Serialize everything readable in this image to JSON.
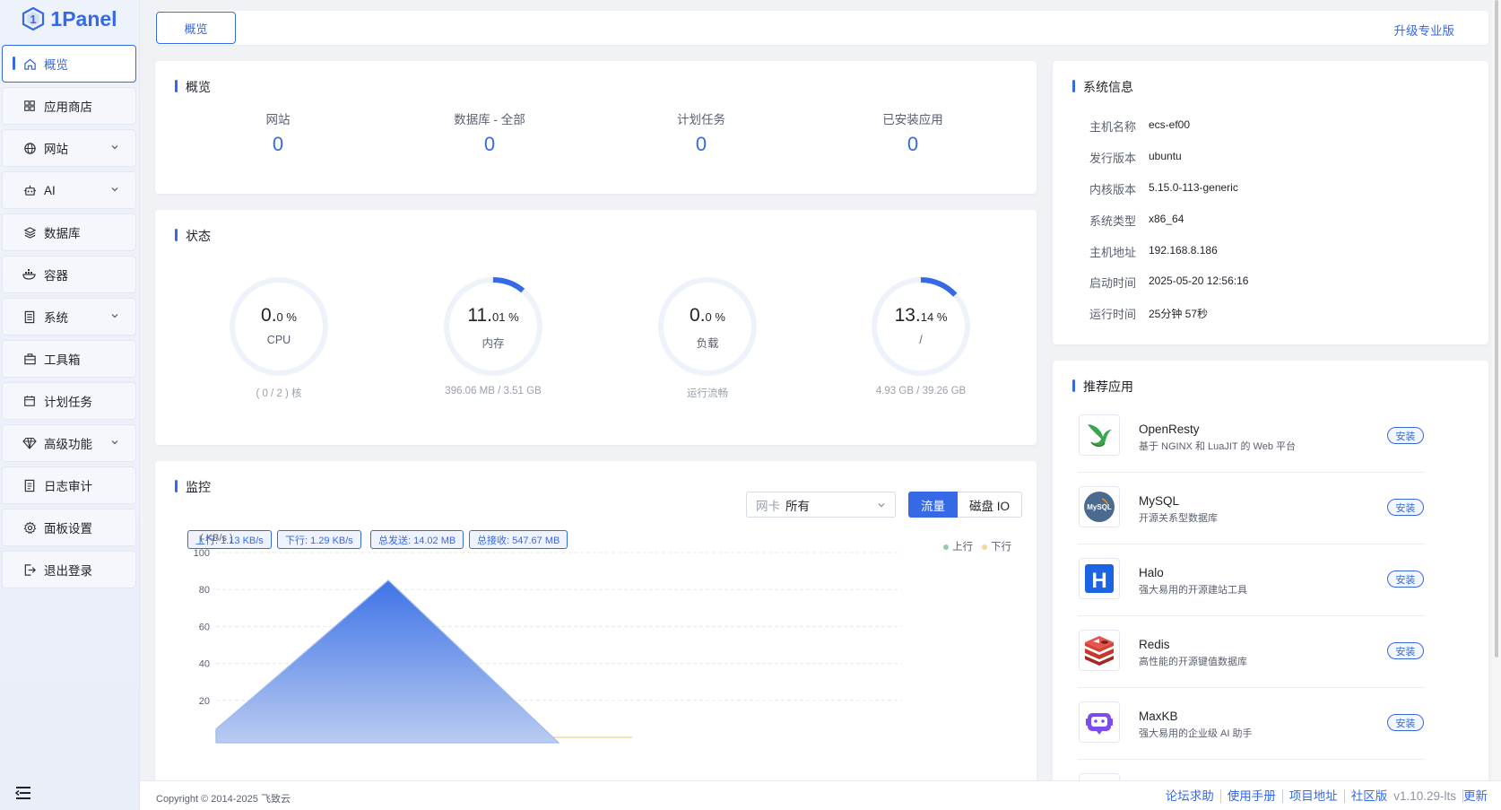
{
  "brand": {
    "name": "1Panel",
    "color": "#3569e6"
  },
  "sidebar": {
    "items": [
      {
        "label": "概览",
        "icon": "home-icon",
        "active": true
      },
      {
        "label": "应用商店",
        "icon": "grid-icon"
      },
      {
        "label": "网站",
        "icon": "globe-icon",
        "expandable": true
      },
      {
        "label": "AI",
        "icon": "robot-icon",
        "expandable": true
      },
      {
        "label": "数据库",
        "icon": "layers-icon"
      },
      {
        "label": "容器",
        "icon": "docker-icon"
      },
      {
        "label": "系统",
        "icon": "server-icon",
        "expandable": true
      },
      {
        "label": "工具箱",
        "icon": "toolbox-icon"
      },
      {
        "label": "计划任务",
        "icon": "calendar-icon"
      },
      {
        "label": "高级功能",
        "icon": "diamond-icon",
        "expandable": true
      },
      {
        "label": "日志审计",
        "icon": "log-icon"
      },
      {
        "label": "面板设置",
        "icon": "gear-icon"
      },
      {
        "label": "退出登录",
        "icon": "logout-icon"
      }
    ]
  },
  "topbar": {
    "tab": "概览",
    "upgrade": "升级专业版"
  },
  "overview": {
    "title": "概览",
    "items": [
      {
        "label": "网站",
        "value": "0"
      },
      {
        "label": "数据库 - 全部",
        "value": "0"
      },
      {
        "label": "计划任务",
        "value": "0"
      },
      {
        "label": "已安装应用",
        "value": "0"
      }
    ]
  },
  "status": {
    "title": "状态",
    "gauges": [
      {
        "int": "0.",
        "dec": "0 %",
        "label": "CPU",
        "sub": "( 0 / 2 ) 核",
        "percent": 0.0
      },
      {
        "int": "11.",
        "dec": "01 %",
        "label": "内存",
        "sub": "396.06 MB / 3.51 GB",
        "percent": 11.01
      },
      {
        "int": "0.",
        "dec": "0 %",
        "label": "负载",
        "sub": "运行流畅",
        "percent": 0.0
      },
      {
        "int": "13.",
        "dec": "14 %",
        "label": "/",
        "sub": "4.93 GB / 39.26 GB",
        "percent": 13.14
      }
    ]
  },
  "monitor": {
    "title": "监控",
    "nic_prefix": "网卡",
    "nic_value": "所有",
    "tabs": [
      "流量",
      "磁盘 IO"
    ],
    "badges": [
      "上行: 1.13 KB/s",
      "下行: 1.29 KB/s",
      "总发送: 14.02 MB",
      "总接收: 547.67 MB"
    ]
  },
  "chart_data": {
    "type": "area",
    "ylabel": "( KB/s )",
    "ylim": [
      0,
      100
    ],
    "yticks": [
      "100",
      "80",
      "60",
      "40",
      "20"
    ],
    "legend_position": "top-right",
    "series": [
      {
        "name": "上行",
        "color": "#4f80e8",
        "values": [
          3,
          85,
          0
        ]
      },
      {
        "name": "下行",
        "color": "#f2d6a2",
        "values": [
          3,
          0,
          0
        ]
      }
    ]
  },
  "sysinfo": {
    "title": "系统信息",
    "rows": [
      {
        "k": "主机名称",
        "v": "ecs-ef00"
      },
      {
        "k": "发行版本",
        "v": "ubuntu"
      },
      {
        "k": "内核版本",
        "v": "5.15.0-113-generic"
      },
      {
        "k": "系统类型",
        "v": "x86_64"
      },
      {
        "k": "主机地址",
        "v": "192.168.8.186"
      },
      {
        "k": "启动时间",
        "v": "2025-05-20 12:56:16"
      },
      {
        "k": "运行时间",
        "v": "25分钟 57秒"
      }
    ]
  },
  "apps": {
    "title": "推荐应用",
    "install_label": "安装",
    "items": [
      {
        "name": "OpenResty",
        "desc": "基于 NGINX 和 LuaJIT 的 Web 平台",
        "icon": "openresty-icon"
      },
      {
        "name": "MySQL",
        "desc": "开源关系型数据库",
        "icon": "mysql-icon"
      },
      {
        "name": "Halo",
        "desc": "强大易用的开源建站工具",
        "icon": "halo-icon"
      },
      {
        "name": "Redis",
        "desc": "高性能的开源键值数据库",
        "icon": "redis-icon"
      },
      {
        "name": "MaxKB",
        "desc": "强大易用的企业级 AI 助手",
        "icon": "maxkb-icon"
      }
    ]
  },
  "footer": {
    "copyright": "Copyright © 2014-2025 飞致云",
    "links": [
      "论坛求助",
      "使用手册",
      "项目地址",
      "社区版",
      "v1.10.29-lts",
      "更新"
    ]
  }
}
